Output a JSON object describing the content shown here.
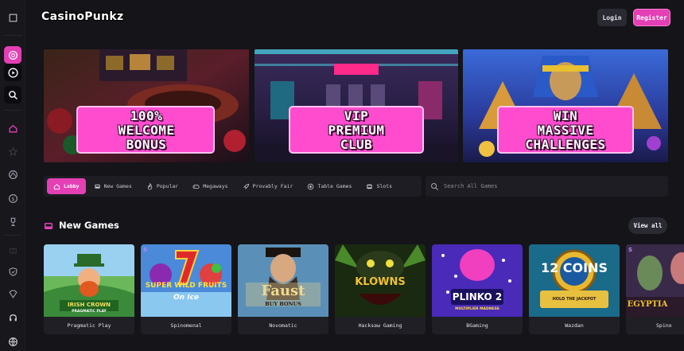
{
  "sidebar": {
    "icons": [
      "menu-icon",
      "chip-icon",
      "play-icon",
      "search-icon",
      "home-icon",
      "star-icon",
      "sports-icon",
      "coin-icon",
      "trophy-icon",
      "gift-icon",
      "shield-icon",
      "vip-icon",
      "headset-icon",
      "globe-icon"
    ]
  },
  "header": {
    "logo": "CasinoPunkz",
    "login_label": "Login",
    "register_label": "Register"
  },
  "banners": [
    {
      "line1": "100%",
      "line2": "WELCOME",
      "line3": "BONUS"
    },
    {
      "line1": "VIP",
      "line2": "PREMIUM",
      "line3": "CLUB"
    },
    {
      "line1": "WIN",
      "line2": "MASSIVE",
      "line3": "CHALLENGES"
    }
  ],
  "tabs": [
    {
      "label": "Lobby",
      "icon": "home-icon"
    },
    {
      "label": "New Games",
      "icon": "bus-icon"
    },
    {
      "label": "Popular",
      "icon": "flame-icon"
    },
    {
      "label": "Megaways",
      "icon": "gamepad-icon"
    },
    {
      "label": "Provably Fair",
      "icon": "rocket-icon"
    },
    {
      "label": "Table Games",
      "icon": "chip-icon"
    },
    {
      "label": "Slots",
      "icon": "slot-icon"
    }
  ],
  "search": {
    "placeholder": "Search All Games"
  },
  "section": {
    "title": "New Games",
    "view_all": "View all"
  },
  "games": [
    {
      "provider": "Pragmatic Play",
      "art": "IRISH CROWN",
      "sub": "PRAGMATIC PLAY"
    },
    {
      "provider": "Spinomenal",
      "art": "SUPER WILD FRUITS",
      "sub": "On Ice"
    },
    {
      "provider": "Novomatic",
      "art": "Faust",
      "sub": "BUY BONUS"
    },
    {
      "provider": "Hacksaw Gaming",
      "art": "KLOWNS",
      "sub": ""
    },
    {
      "provider": "BGaming",
      "art": "PLINKO 2",
      "sub": "MULTIPLIER MADNESS"
    },
    {
      "provider": "Wazdan",
      "art": "12 COINS",
      "sub": "HOLD THE JACKPOT"
    },
    {
      "provider": "Spino",
      "art": "EGYPTIA",
      "sub": ""
    }
  ],
  "colors": {
    "accent": "#e43fb4",
    "background": "#141419",
    "panel": "#1d1d23"
  }
}
